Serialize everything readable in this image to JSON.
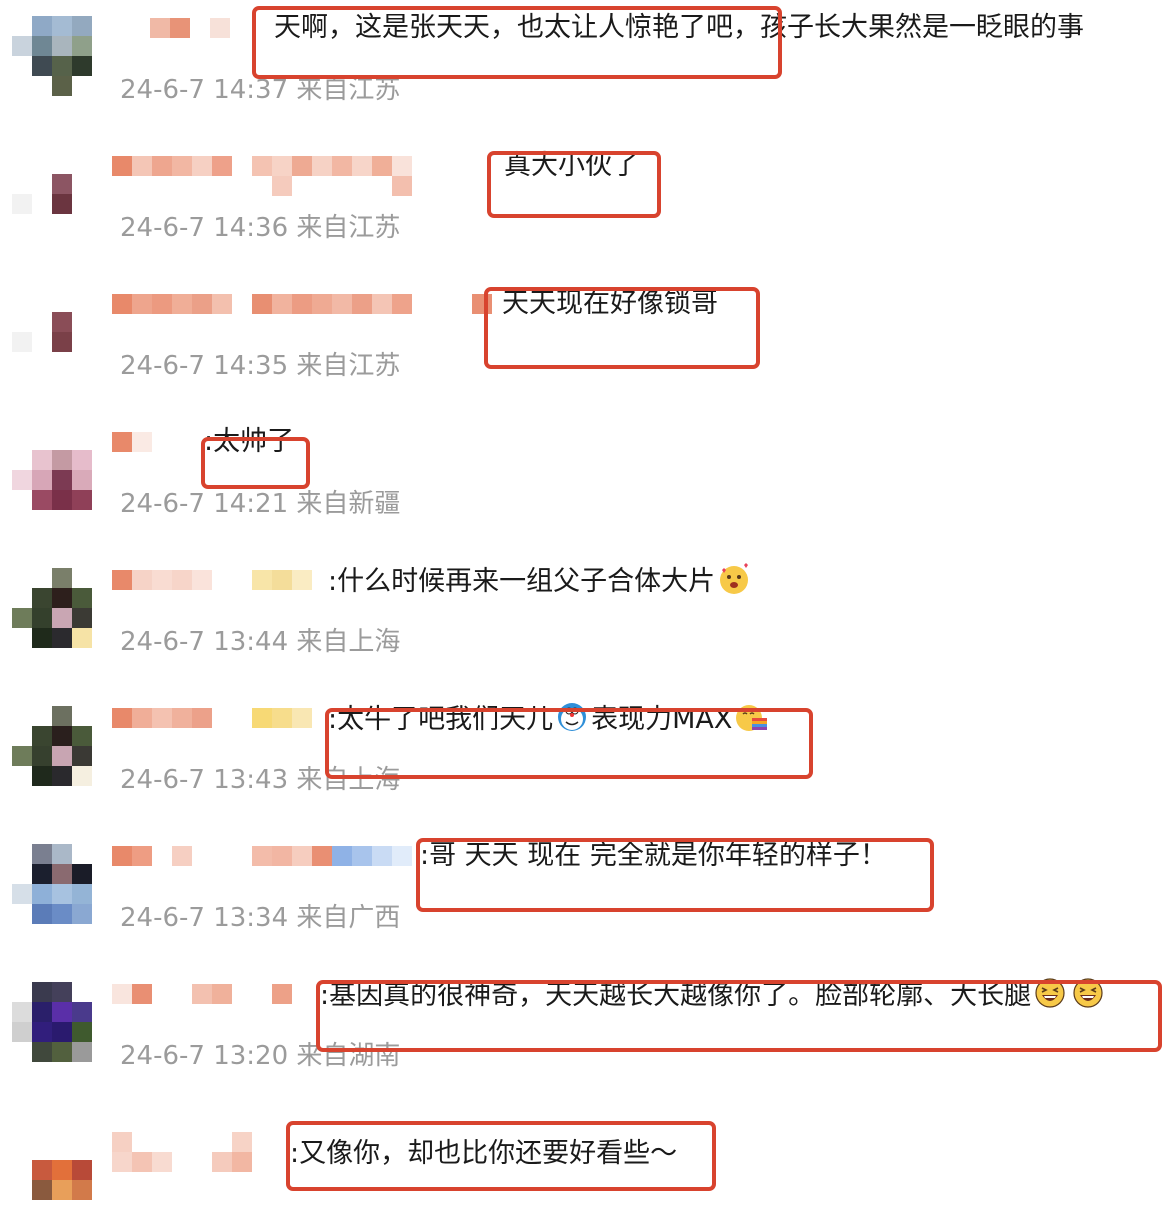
{
  "comments": [
    {
      "text": "天啊，这是张天天，也太让人惊艳了吧，孩子长大果然是一眨眼的事",
      "timestamp": "24-6-7 14:37",
      "location": "来自江苏"
    },
    {
      "text": "真大小伙了",
      "timestamp": "24-6-7 14:36",
      "location": "来自江苏"
    },
    {
      "text": "天天现在好像锁哥",
      "timestamp": "24-6-7 14:35",
      "location": "来自江苏"
    },
    {
      "text": ":太帅了",
      "timestamp": "24-6-7 14:21",
      "location": "来自新疆"
    },
    {
      "text": ":什么时候再来一组父子合体大片",
      "timestamp": "24-6-7 13:44",
      "location": "来自上海"
    },
    {
      "text_a": ":太牛了吧我们天儿",
      "text_b": "表现力MAX",
      "timestamp": "24-6-7 13:43",
      "location": "来自上海"
    },
    {
      "text": ":哥  天天 现在 完全就是你年轻的样子！",
      "timestamp": "24-6-7 13:34",
      "location": "来自广西"
    },
    {
      "text": ":基因真的很神奇，天天越长大越像你了。脸部轮廓、大长腿",
      "timestamp": "24-6-7 13:20",
      "location": "来自湖南"
    },
    {
      "text": ":又像你，却也比你还要好看些～",
      "timestamp": "",
      "location": ""
    }
  ],
  "colors": {
    "highlight": "#d8432e",
    "meta_text": "#9b9b9b",
    "body_text": "#1a1a1a"
  },
  "icons": [
    "pixelated-avatar",
    "blurred-username",
    "hearts-face-emoji",
    "doraemon-emoji",
    "rainbow-face-emoji",
    "laughing-emoji"
  ]
}
